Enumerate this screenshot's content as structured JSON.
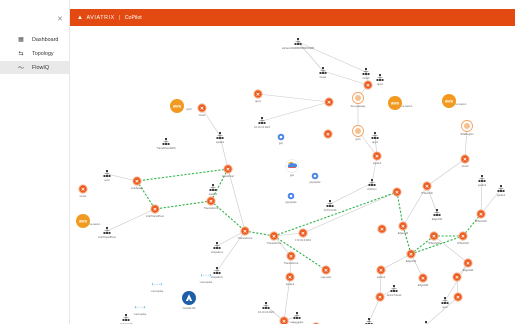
{
  "header": {
    "brand": "AVIATRIX",
    "product": "CoPilot",
    "accent": "#e24a11"
  },
  "sidebar": {
    "collapse_icon": "close-icon",
    "items": [
      {
        "label": "Dashboard",
        "icon": "dashboard-icon",
        "active": false
      },
      {
        "label": "Topology",
        "icon": "topology-icon",
        "active": false
      },
      {
        "label": "FlowIQ",
        "icon": "flowiq-icon",
        "active": true
      }
    ]
  },
  "topology": {
    "labels": {
      "top_subnet": "subnet-01fd6f0b5f69bb5d8b",
      "zone1": "zone1",
      "zone2": "zone2",
      "app1": "app1",
      "dev_gateway": "dev-gateway",
      "us_west_1": "us-west-1",
      "sfe_region": "SFERegion",
      "transit_peer": "TransitPeerAWS",
      "onprem": "OnPrem",
      "gcp": "gcp",
      "gcp_spoke": "gcpspoke",
      "az_peer": "AzurePeer",
      "az_spoke_a": "azspoke-a",
      "az_spoke_b": "azspoke-b",
      "transit_az": "TransitAzure",
      "link_spoke": "LinkSpoke",
      "link_transit": "LinkTransitPeer",
      "edge": "EdgeGW",
      "ipsec": "IPSecGW",
      "spoke1": "spoke1",
      "spoke2": "spoke2",
      "vpc1": "vpc1",
      "vpc2": "vpc2",
      "central": "Central-US",
      "vnet": "vnet-spoke",
      "ip1": "10.10.10.0/24",
      "ip2": "10.8.0.0/16",
      "ip3": "172.31.0.0/16",
      "vgw": "vgw-peer",
      "azure_transit": "AzureTransit"
    },
    "badges": {
      "aws": "aws"
    },
    "colors": {
      "gateway": "#ec5a1e",
      "link": "#2fb34a",
      "aws": "#f29a1f",
      "azure": "#1e5fa8",
      "gcp": "#4a86e8"
    }
  }
}
